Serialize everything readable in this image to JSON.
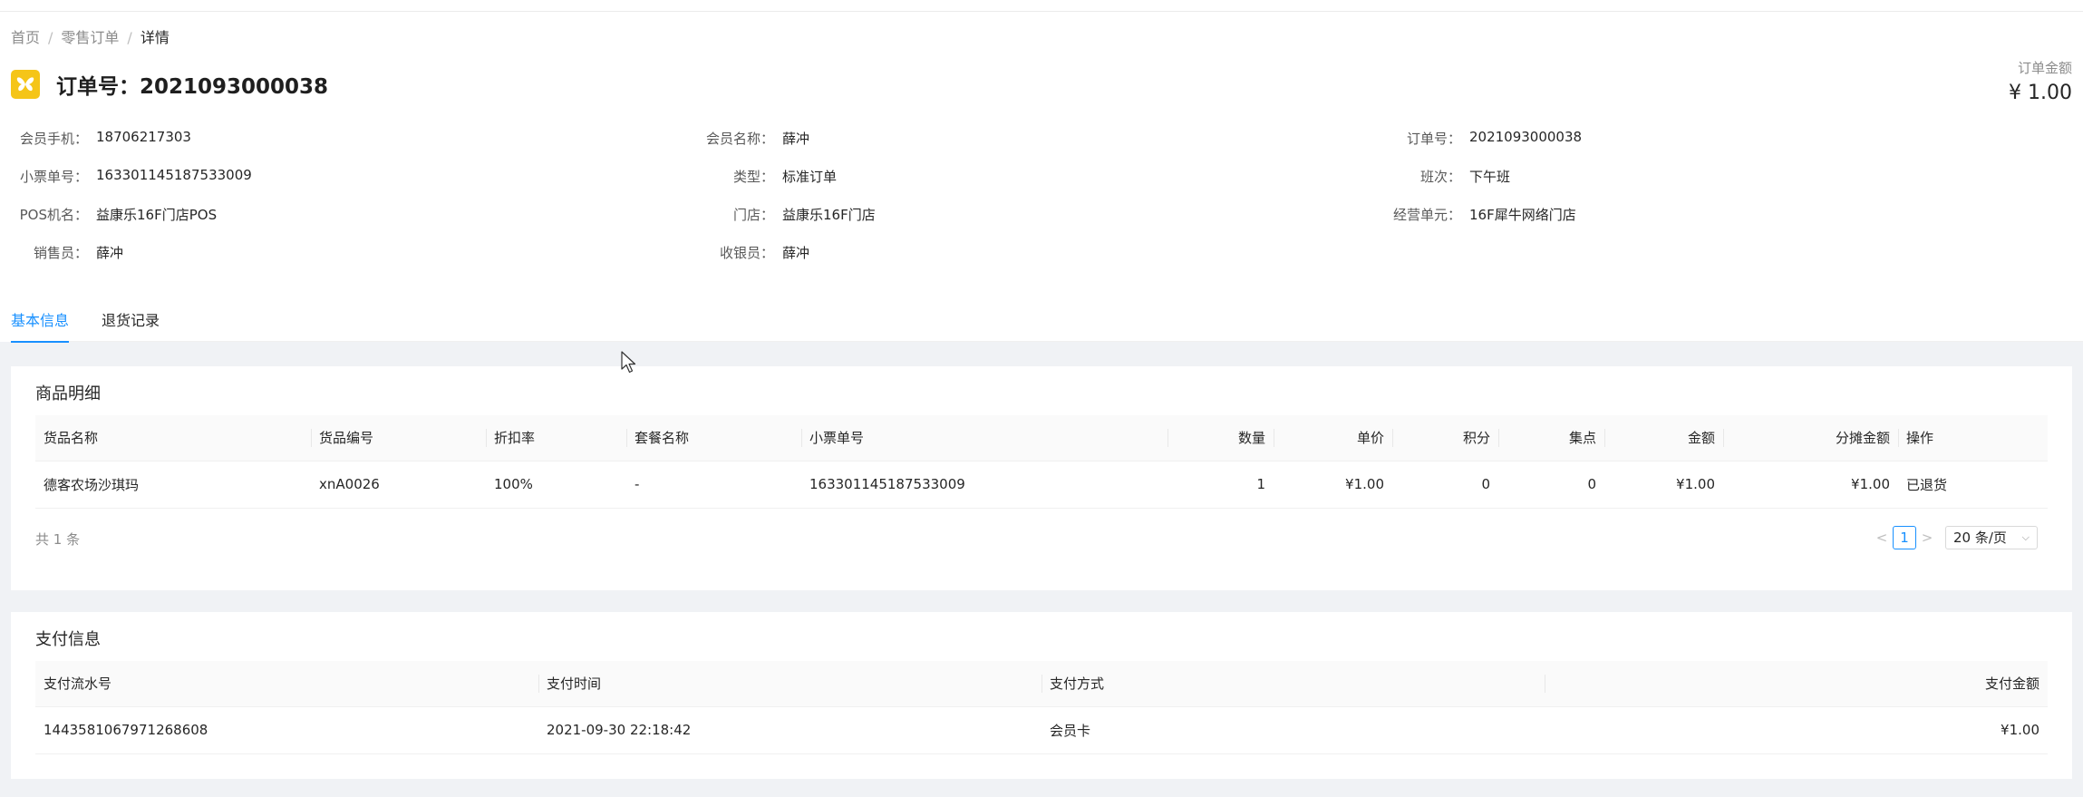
{
  "breadcrumb": {
    "home": "首页",
    "list": "零售订单",
    "current": "详情"
  },
  "title": "订单号：2021093000038",
  "order_amount": {
    "label": "订单金额",
    "value": "¥ 1.00"
  },
  "details": {
    "member_phone": {
      "label": "会员手机：",
      "value": "18706217303"
    },
    "member_name": {
      "label": "会员名称：",
      "value": "薛冲"
    },
    "order_no": {
      "label": "订单号：",
      "value": "2021093000038"
    },
    "receipt_no": {
      "label": "小票单号：",
      "value": "163301145187533009"
    },
    "type": {
      "label": "类型：",
      "value": "标准订单"
    },
    "shift": {
      "label": "班次：",
      "value": "下午班"
    },
    "pos_name": {
      "label": "POS机名：",
      "value": "益康乐16F门店POS"
    },
    "store": {
      "label": "门店：",
      "value": "益康乐16F门店"
    },
    "business_unit": {
      "label": "经营单元：",
      "value": "16F犀牛网络门店"
    },
    "salesperson": {
      "label": "销售员：",
      "value": "薛冲"
    },
    "cashier": {
      "label": "收银员：",
      "value": "薛冲"
    }
  },
  "tabs": [
    {
      "label": "基本信息"
    },
    {
      "label": "退货记录"
    }
  ],
  "goods": {
    "title": "商品明细",
    "columns": [
      "货品名称",
      "货品编号",
      "折扣率",
      "套餐名称",
      "小票单号",
      "数量",
      "单价",
      "积分",
      "集点",
      "金额",
      "分摊金额",
      "操作"
    ],
    "rows": [
      [
        "德客农场沙琪玛",
        "xnA0026",
        "100%",
        "-",
        "163301145187533009",
        "1",
        "¥1.00",
        "0",
        "0",
        "¥1.00",
        "¥1.00",
        "已退货"
      ]
    ],
    "total": "共 1 条",
    "pager": {
      "prev": "<",
      "page": "1",
      "next": ">",
      "page_size": "20 条/页"
    }
  },
  "payment": {
    "title": "支付信息",
    "columns": [
      "支付流水号",
      "支付时间",
      "支付方式",
      "支付金额"
    ],
    "rows": [
      [
        "1443581067971268608",
        "2021-09-30 22:18:42",
        "会员卡",
        "¥1.00"
      ]
    ]
  },
  "colors": {
    "accent": "#1890ff",
    "logo": "#f5c518"
  },
  "icons": {
    "logo": "butterfly-icon",
    "cursor": "mouse-cursor-icon"
  }
}
